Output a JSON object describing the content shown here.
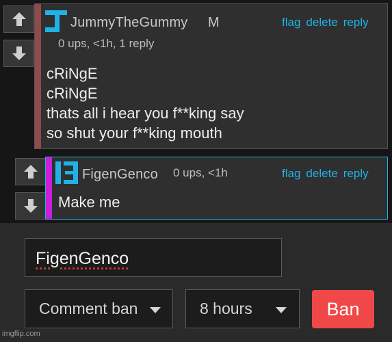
{
  "comments": [
    {
      "username": "JummyTheGummy",
      "badge": "M",
      "meta": "0 ups, <1h, 1 reply",
      "actions": [
        "flag",
        "delete",
        "reply"
      ],
      "body": "cRiNgE\ncRiNgE\nthats all i hear you f**king say\nso shut your f**king mouth",
      "bar_color": "#8f4b4b",
      "avatar_color": "#1fb2e6"
    },
    {
      "username": "FigenGenco",
      "meta": "0 ups, <1h",
      "actions": [
        "flag",
        "delete",
        "reply"
      ],
      "body": "Make me",
      "bar_color": "#c81fd8",
      "avatar_color": "#1fb2e6",
      "border_color": "#1fb2e6"
    }
  ],
  "ban_form": {
    "username_value": "FigenGenco",
    "ban_type": "Comment ban",
    "duration": "8 hours",
    "ban_button": "Ban",
    "ban_button_color": "#f04848"
  },
  "watermark": "imgflip.com",
  "icons": [
    "upvote-arrow-icon",
    "downvote-arrow-icon",
    "user-avatar-icon",
    "dropdown-caret-icon"
  ]
}
